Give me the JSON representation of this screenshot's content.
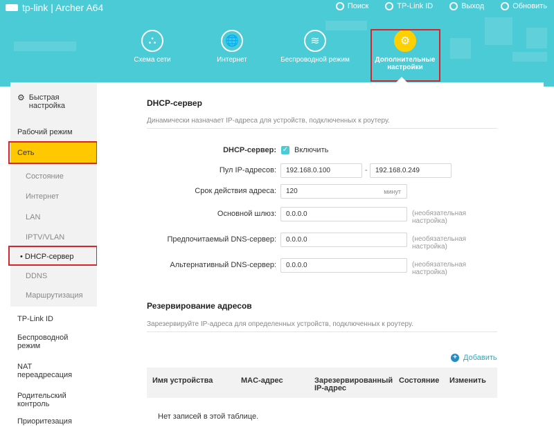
{
  "header": {
    "logo_text": "tp-link | Archer A64",
    "links": [
      {
        "label": "Поиск",
        "icon": "search-icon"
      },
      {
        "label": "TP-Link ID",
        "icon": "user-icon"
      },
      {
        "label": "Выход",
        "icon": "logout-icon"
      },
      {
        "label": "Обновить",
        "icon": "refresh-icon"
      }
    ],
    "nav": [
      {
        "label": "Схема сети",
        "icon": "network-map-icon",
        "glyph": "⛬"
      },
      {
        "label": "Интернет",
        "icon": "globe-icon",
        "glyph": "🌐"
      },
      {
        "label": "Беспроводной режим",
        "icon": "wifi-icon",
        "glyph": "≋"
      },
      {
        "label": "Дополнительные настройки",
        "icon": "gear-icon",
        "glyph": "⚙"
      }
    ],
    "active_nav": 3
  },
  "sidebar": {
    "quick_setup": "Быстрая настройка",
    "op_mode": "Рабочий режим",
    "network": "Сеть",
    "sub": [
      "Состояние",
      "Интернет",
      "LAN",
      "IPTV/VLAN",
      "DHCP-сервер",
      "DDNS",
      "Маршрутизация"
    ],
    "active_sub": "DHCP-сервер",
    "items_after": [
      "TP-Link ID",
      "Беспроводной режим",
      "NAT переадресация",
      "Родительский контроль",
      "Приоритезация"
    ]
  },
  "dhcp": {
    "title": "DHCP-сервер",
    "description": "Динамически назначает IP-адреса для устройств, подключенных к роутеру.",
    "enable_label": "DHCP-сервер:",
    "enable_text": "Включить",
    "enabled": true,
    "pool_label": "Пул IP-адресов:",
    "pool_start": "192.168.0.100",
    "pool_dash": "-",
    "pool_end": "192.168.0.249",
    "lease_label": "Срок действия адреса:",
    "lease_value": "120",
    "lease_unit": "минут",
    "gateway_label": "Основной шлюз:",
    "gateway_value": "0.0.0.0",
    "dns1_label": "Предпочитаемый DNS-сервер:",
    "dns1_value": "0.0.0.0",
    "dns2_label": "Альтернативный DNS-сервер:",
    "dns2_value": "0.0.0.0",
    "optional_note": "(необязательная настройка)"
  },
  "reservation": {
    "title": "Резервирование адресов",
    "description": "Зарезервируйте IP-адреса для определенных устройств, подключенных к роутеру.",
    "add_label": "Добавить",
    "columns": [
      "Имя устройства",
      "MAC-адрес",
      "Зарезервированный IP-адрес",
      "Состояние",
      "Изменить"
    ],
    "empty_text": "Нет записей в этой таблице."
  },
  "colors": {
    "header_bg": "#4acbd6",
    "accent_yellow": "#ffc800",
    "highlight_red": "#d8232a",
    "link_blue": "#2aa9c2"
  }
}
